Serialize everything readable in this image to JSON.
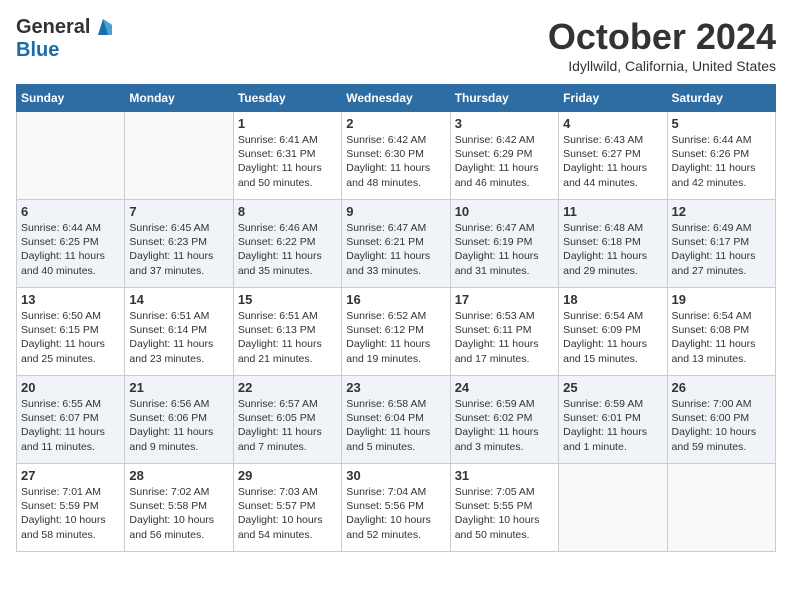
{
  "header": {
    "logo_general": "General",
    "logo_blue": "Blue",
    "title": "October 2024",
    "subtitle": "Idyllwild, California, United States"
  },
  "days_of_week": [
    "Sunday",
    "Monday",
    "Tuesday",
    "Wednesday",
    "Thursday",
    "Friday",
    "Saturday"
  ],
  "weeks": [
    [
      {
        "day": "",
        "info": ""
      },
      {
        "day": "",
        "info": ""
      },
      {
        "day": "1",
        "info": "Sunrise: 6:41 AM\nSunset: 6:31 PM\nDaylight: 11 hours and 50 minutes."
      },
      {
        "day": "2",
        "info": "Sunrise: 6:42 AM\nSunset: 6:30 PM\nDaylight: 11 hours and 48 minutes."
      },
      {
        "day": "3",
        "info": "Sunrise: 6:42 AM\nSunset: 6:29 PM\nDaylight: 11 hours and 46 minutes."
      },
      {
        "day": "4",
        "info": "Sunrise: 6:43 AM\nSunset: 6:27 PM\nDaylight: 11 hours and 44 minutes."
      },
      {
        "day": "5",
        "info": "Sunrise: 6:44 AM\nSunset: 6:26 PM\nDaylight: 11 hours and 42 minutes."
      }
    ],
    [
      {
        "day": "6",
        "info": "Sunrise: 6:44 AM\nSunset: 6:25 PM\nDaylight: 11 hours and 40 minutes."
      },
      {
        "day": "7",
        "info": "Sunrise: 6:45 AM\nSunset: 6:23 PM\nDaylight: 11 hours and 37 minutes."
      },
      {
        "day": "8",
        "info": "Sunrise: 6:46 AM\nSunset: 6:22 PM\nDaylight: 11 hours and 35 minutes."
      },
      {
        "day": "9",
        "info": "Sunrise: 6:47 AM\nSunset: 6:21 PM\nDaylight: 11 hours and 33 minutes."
      },
      {
        "day": "10",
        "info": "Sunrise: 6:47 AM\nSunset: 6:19 PM\nDaylight: 11 hours and 31 minutes."
      },
      {
        "day": "11",
        "info": "Sunrise: 6:48 AM\nSunset: 6:18 PM\nDaylight: 11 hours and 29 minutes."
      },
      {
        "day": "12",
        "info": "Sunrise: 6:49 AM\nSunset: 6:17 PM\nDaylight: 11 hours and 27 minutes."
      }
    ],
    [
      {
        "day": "13",
        "info": "Sunrise: 6:50 AM\nSunset: 6:15 PM\nDaylight: 11 hours and 25 minutes."
      },
      {
        "day": "14",
        "info": "Sunrise: 6:51 AM\nSunset: 6:14 PM\nDaylight: 11 hours and 23 minutes."
      },
      {
        "day": "15",
        "info": "Sunrise: 6:51 AM\nSunset: 6:13 PM\nDaylight: 11 hours and 21 minutes."
      },
      {
        "day": "16",
        "info": "Sunrise: 6:52 AM\nSunset: 6:12 PM\nDaylight: 11 hours and 19 minutes."
      },
      {
        "day": "17",
        "info": "Sunrise: 6:53 AM\nSunset: 6:11 PM\nDaylight: 11 hours and 17 minutes."
      },
      {
        "day": "18",
        "info": "Sunrise: 6:54 AM\nSunset: 6:09 PM\nDaylight: 11 hours and 15 minutes."
      },
      {
        "day": "19",
        "info": "Sunrise: 6:54 AM\nSunset: 6:08 PM\nDaylight: 11 hours and 13 minutes."
      }
    ],
    [
      {
        "day": "20",
        "info": "Sunrise: 6:55 AM\nSunset: 6:07 PM\nDaylight: 11 hours and 11 minutes."
      },
      {
        "day": "21",
        "info": "Sunrise: 6:56 AM\nSunset: 6:06 PM\nDaylight: 11 hours and 9 minutes."
      },
      {
        "day": "22",
        "info": "Sunrise: 6:57 AM\nSunset: 6:05 PM\nDaylight: 11 hours and 7 minutes."
      },
      {
        "day": "23",
        "info": "Sunrise: 6:58 AM\nSunset: 6:04 PM\nDaylight: 11 hours and 5 minutes."
      },
      {
        "day": "24",
        "info": "Sunrise: 6:59 AM\nSunset: 6:02 PM\nDaylight: 11 hours and 3 minutes."
      },
      {
        "day": "25",
        "info": "Sunrise: 6:59 AM\nSunset: 6:01 PM\nDaylight: 11 hours and 1 minute."
      },
      {
        "day": "26",
        "info": "Sunrise: 7:00 AM\nSunset: 6:00 PM\nDaylight: 10 hours and 59 minutes."
      }
    ],
    [
      {
        "day": "27",
        "info": "Sunrise: 7:01 AM\nSunset: 5:59 PM\nDaylight: 10 hours and 58 minutes."
      },
      {
        "day": "28",
        "info": "Sunrise: 7:02 AM\nSunset: 5:58 PM\nDaylight: 10 hours and 56 minutes."
      },
      {
        "day": "29",
        "info": "Sunrise: 7:03 AM\nSunset: 5:57 PM\nDaylight: 10 hours and 54 minutes."
      },
      {
        "day": "30",
        "info": "Sunrise: 7:04 AM\nSunset: 5:56 PM\nDaylight: 10 hours and 52 minutes."
      },
      {
        "day": "31",
        "info": "Sunrise: 7:05 AM\nSunset: 5:55 PM\nDaylight: 10 hours and 50 minutes."
      },
      {
        "day": "",
        "info": ""
      },
      {
        "day": "",
        "info": ""
      }
    ]
  ]
}
